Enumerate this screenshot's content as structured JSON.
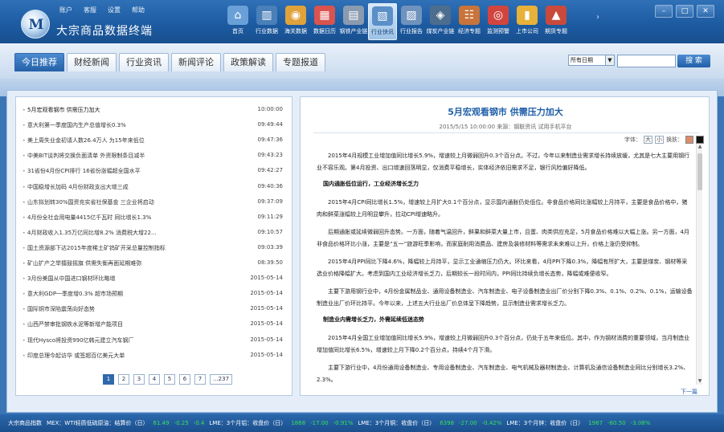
{
  "app": {
    "title": "大宗商品数据终端",
    "logo_letter": "M"
  },
  "top_menu": [
    "账户",
    "客服",
    "设置",
    "帮助"
  ],
  "toolbar": [
    {
      "label": "首页",
      "icon": "home-icon",
      "color": "#6aa0d8",
      "glyph": "⌂"
    },
    {
      "label": "行业数据",
      "icon": "industry-data-icon",
      "color": "#4a7fb8",
      "glyph": "▥"
    },
    {
      "label": "海关数据",
      "icon": "customs-data-icon",
      "color": "#e0a23a",
      "glyph": "◉"
    },
    {
      "label": "数据日历",
      "icon": "calendar-icon",
      "color": "#d9534f",
      "glyph": "▦"
    },
    {
      "label": "钢铁产业链",
      "icon": "steel-chain-icon",
      "color": "#8a9bb0",
      "glyph": "▤"
    },
    {
      "label": "行业快讯",
      "icon": "newsflash-icon",
      "color": "#5b8fc7",
      "glyph": "▧"
    },
    {
      "label": "行业报告",
      "icon": "report-icon",
      "color": "#6f93bd",
      "glyph": "▨"
    },
    {
      "label": "煤炭产业链",
      "icon": "coal-chain-icon",
      "color": "#4d6d8f",
      "glyph": "◈"
    },
    {
      "label": "经济专题",
      "icon": "economy-topic-icon",
      "color": "#c8743a",
      "glyph": "☷"
    },
    {
      "label": "监测预警",
      "icon": "monitor-warning-icon",
      "color": "#d2453f",
      "glyph": "◎"
    },
    {
      "label": "上市公司",
      "icon": "listed-company-icon",
      "color": "#e8b13a",
      "glyph": "▮"
    },
    {
      "label": "期货专题",
      "icon": "futures-topic-icon",
      "color": "#c94a3c",
      "glyph": "▲"
    }
  ],
  "tabs": [
    "今日推荐",
    "财经新闻",
    "行业资讯",
    "新闻评论",
    "政策解读",
    "专题报道"
  ],
  "search": {
    "date_option": "所有日期",
    "button": "搜 索",
    "placeholder": ""
  },
  "news": [
    {
      "title": "5月宏观看钢市 供需压力加大",
      "date": "10:00:00"
    },
    {
      "title": "意大利第一季度国内生产总值增长0.3%",
      "date": "09:49:44"
    },
    {
      "title": "美上周失业金初请人数26.4万人 为15年来低位",
      "date": "09:47:36"
    },
    {
      "title": "中美BIT谈判将交换负面清单 外资限制条目减半",
      "date": "09:43:23"
    },
    {
      "title": "31省份4月份CPI排行 16省份涨幅超全国水平",
      "date": "09:42:27"
    },
    {
      "title": "中国稳增长加码 4月份财政支出大增三成",
      "date": "09:40:36"
    },
    {
      "title": "山东拟划转30%国资充实省社保基金 三企业将启动",
      "date": "09:37:09"
    },
    {
      "title": "4月份全社会用电量4415亿千瓦时 同比增长1.3%",
      "date": "09:11:29"
    },
    {
      "title": "4月财政收入1.35万亿同比增8.2% 消费税大增22...",
      "date": "09:10:57"
    },
    {
      "title": "国土资源部下达2015年度稀土矿钨矿开采总量控制指标",
      "date": "09:03:39"
    },
    {
      "title": "矿山扩产之举擂鼓摇旗 供需失衡再面延期难弥",
      "date": "08:39:50"
    },
    {
      "title": "3月份美国从中国进口钢材环比略增",
      "date": "2015-05-14"
    },
    {
      "title": "意大利GDP一季度增0.3% 超市场预期",
      "date": "2015-05-14"
    },
    {
      "title": "国际铜市深陷震荡向好态势",
      "date": "2015-05-14"
    },
    {
      "title": "山西严禁审批钢铁水泥等新增产能项目",
      "date": "2015-05-14"
    },
    {
      "title": "现代Hysco将投资990亿韩元建立汽车钢厂",
      "date": "2015-05-14"
    },
    {
      "title": "印度总理今起访华 或签超百亿美元大单",
      "date": "2015-05-14"
    }
  ],
  "pager": [
    "1",
    "2",
    "3",
    "4",
    "5",
    "6",
    "7",
    "...237"
  ],
  "article": {
    "title": "5月宏观看钢市 供需压力加大",
    "meta": "2015/5/15 10:00:00 来源：钢联资讯 试用手机平台",
    "font_label": "字体：",
    "font_large": "大",
    "font_small": "小",
    "skin_label": "换肤：",
    "skin_colors": [
      "#d98d6d",
      "#111111"
    ],
    "next": "下一篇",
    "blocks": [
      {
        "type": "p",
        "text": "2015年4月规模工业增加值同比增长5.9%，增速较上月微弱回升0.3个百分点。不过，今年以来制造业需求增长持续放缓，尤其是七大主要用钢行业不容乐观。第4月投资、出口增速回落明显，仅消费平稳增长，实体经济依旧需求不足，银行风险偏好降低。"
      },
      {
        "type": "h",
        "text": "国内通胀低位运行，工业经济增长乏力"
      },
      {
        "type": "p",
        "text": "2015年4月CPI同比增长1.5%，增速较上月扩大0.1个百分点，显示国内通胀仍处低位。非食品价格同比涨幅较上月持平，主要是食品价格中，猪肉和鲜菜涨幅较上月明显攀升，拉动CPI增速略升。"
      },
      {
        "type": "p",
        "text": "后期通胀或延续微弱回升态势。一方面，随着气温回升，鲜果和鲜菜大量上市，且蛋、肉类供应充足，5月食品价格难以大幅上涨。另一方面，4月非食品价格环比小涨，主要是“五一”旅游旺季影响，而家庭耐用消费品、建房及装修材料等需求未来难以上升，价格上涨仍受抑制。"
      },
      {
        "type": "p",
        "text": "2015年4月PPI同比下降4.6%，降幅较上月持平，显示工业通缩压力仍大。环比来看，4月PPI下降0.3%，降幅有所扩大，主要是煤炭、钢材等采选业价格降幅扩大。考虑到国内工业经济增长乏力，后期较长一段时间内，PPI同比持续负增长态势，降幅或难便收窄。"
      },
      {
        "type": "p",
        "text": "主要下游用钢行业中，4月份金属制品业、通用设备制造业、汽车制造业、电子设备制造业出厂价分别下降0.3%、0.1%、0.2%、0.1%，运输设备制造业出厂价环比持平。今年以来，上述五大行业出厂价总体呈下降趋势，显示制造业需求增长乏力。"
      },
      {
        "type": "h",
        "text": "制造业内需增长乏力，外需延续低迷态势"
      },
      {
        "type": "p",
        "text": "2015年4月全国工业增加值同比增长5.9%，增速较上月微弱回升0.3个百分点，仍处于五年来低位。其中，作为钢材消费的重要领域，当月制造业增加值同比增长6.5%，增速较上月下降0.2个百分点，持续4个月下滑。"
      },
      {
        "type": "p",
        "text": "主要下游行业中，4月份通用设备制造业、专用设备制造业、汽车制造业、电气机械及器材制造业、计算机及通信设备制造业同比分别增长3.2%、2.3%。"
      }
    ]
  },
  "status_bar": [
    {
      "text": "大宗商品指数",
      "color": "#ffffff"
    },
    {
      "text": "MEX：WTI轻质低硫原油：结算价（日）",
      "color": "#ffffff"
    },
    {
      "text": "61.49",
      "color": "#36e05a"
    },
    {
      "text": "-0.25",
      "color": "#36e05a"
    },
    {
      "text": "-0.4",
      "color": "#36e05a"
    },
    {
      "text": "LME：3个月铝：收盘价（日）",
      "color": "#ffffff"
    },
    {
      "text": "1868",
      "color": "#36e05a"
    },
    {
      "text": "-17.00",
      "color": "#36e05a"
    },
    {
      "text": "-0.91%",
      "color": "#36e05a"
    },
    {
      "text": "LME：3个月铜：收盘价（日）",
      "color": "#ffffff"
    },
    {
      "text": "6398",
      "color": "#36e05a"
    },
    {
      "text": "-27.00",
      "color": "#36e05a"
    },
    {
      "text": "-0.42%",
      "color": "#36e05a"
    },
    {
      "text": "LME：3个月锌：收盘价（日）",
      "color": "#ffffff"
    },
    {
      "text": "1967",
      "color": "#36e05a"
    },
    {
      "text": "-60.50",
      "color": "#36e05a"
    },
    {
      "text": "-3.08%",
      "color": "#36e05a"
    }
  ],
  "window_buttons": [
    "–",
    "□",
    "✕"
  ]
}
